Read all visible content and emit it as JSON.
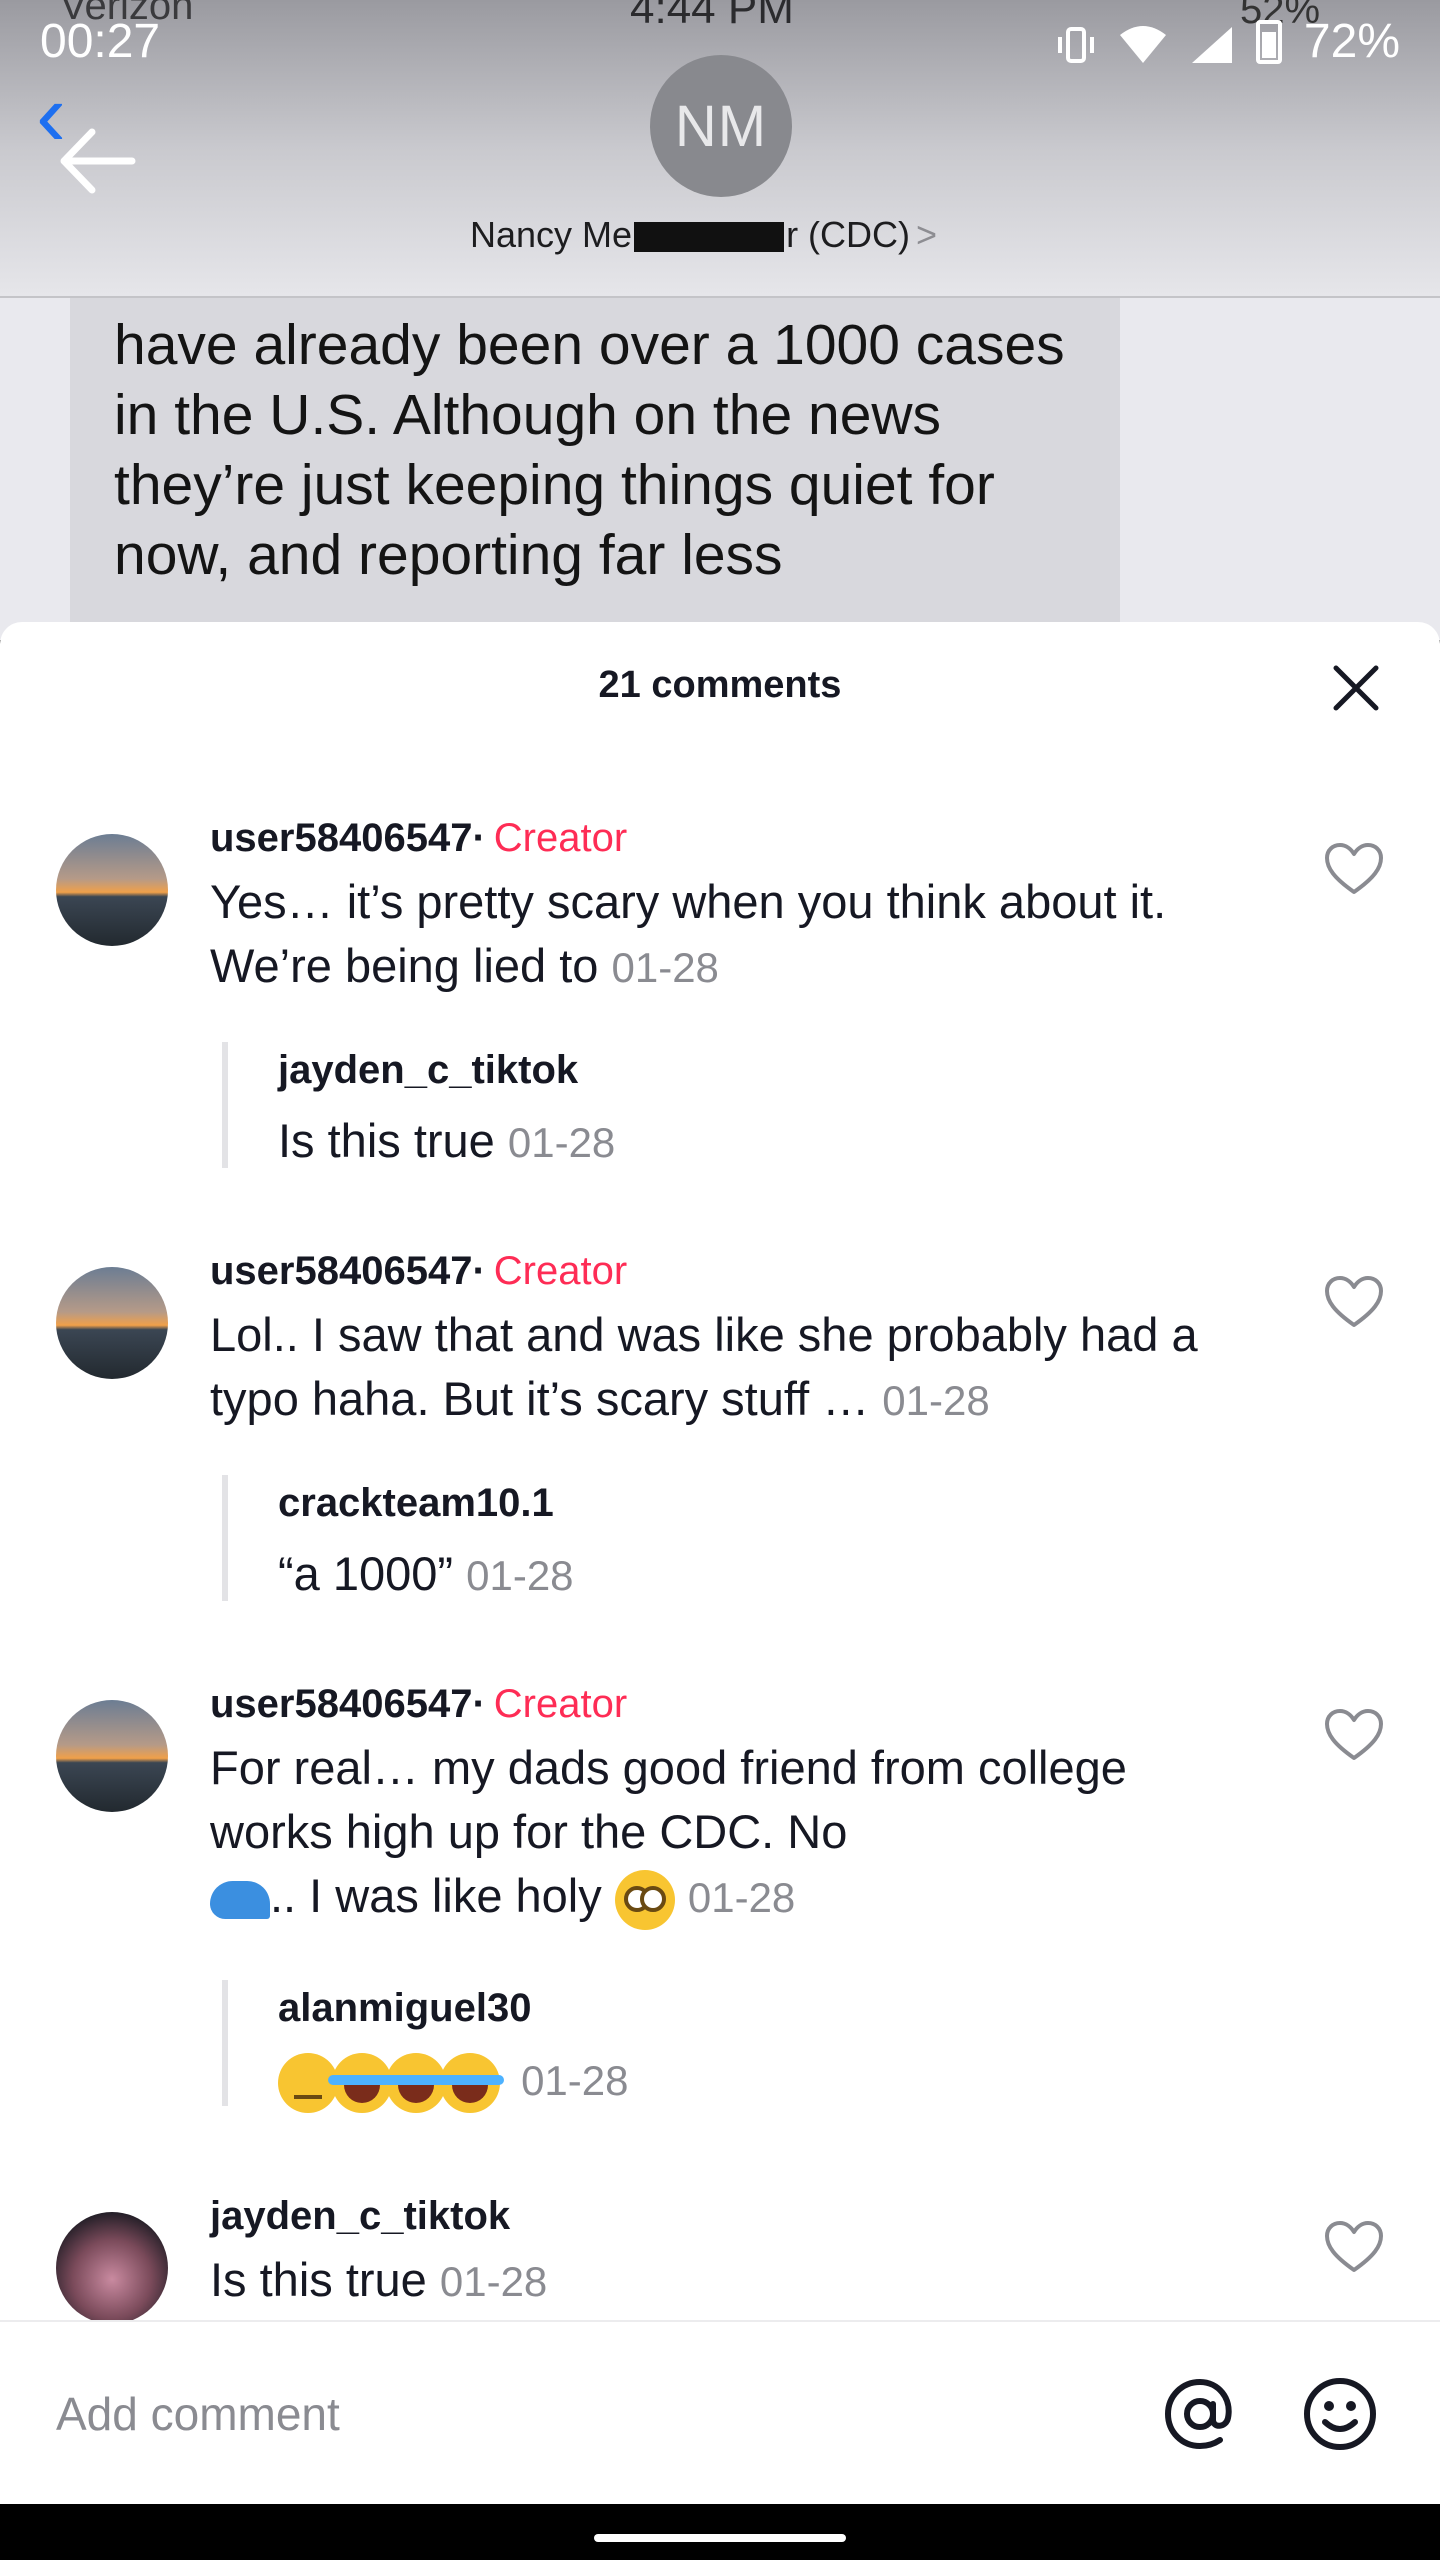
{
  "status_bar": {
    "time": "00:27",
    "battery": "72%"
  },
  "video": {
    "carrier": "Verizon",
    "ghost_time": "4:44 PM",
    "ghost_battery": "52%",
    "contact_initials": "NM",
    "contact_name_start": "Nancy Me",
    "contact_name_end": "r (CDC)",
    "contact_chevron": ">",
    "message_text": "have already been over a 1000 cases in the U.S. Although on the news they’re just keeping things quiet for now, and reporting far less"
  },
  "sheet": {
    "comment_count": "21 comments"
  },
  "comments": [
    {
      "username": "user58406547·",
      "badge": "Creator",
      "text": "Yes… it’s pretty scary when you think about it. We’re being lied to",
      "date": "01-28",
      "reply": {
        "username": "jayden_c_tiktok",
        "text": "Is this true",
        "date": "01-28"
      }
    },
    {
      "username": "user58406547·",
      "badge": "Creator",
      "text": "Lol.. I saw that and was like she probably had a typo haha. But it’s scary stuff …",
      "date": "01-28",
      "reply": {
        "username": "crackteam10.1",
        "text": "“a 1000”",
        "date": "01-28"
      }
    },
    {
      "username": "user58406547·",
      "badge": "Creator",
      "text_line1": "For real… my dads good friend from college works high up for the CDC. No",
      "text_line2": ".. I was like holy",
      "date": "01-28",
      "reply": {
        "username": "alanmiguel30",
        "date": "01-28"
      }
    },
    {
      "username": "jayden_c_tiktok",
      "text": "Is this true",
      "date": "01-28"
    }
  ],
  "comment_bar": {
    "placeholder": "Add comment"
  },
  "icons": {
    "heart": "heart-icon",
    "close": "close-icon",
    "at": "at-icon",
    "emoji": "smiley-icon",
    "back": "back-arrow-icon"
  },
  "colors": {
    "creator": "#fe2c55",
    "text": "#161823",
    "muted": "#8a8b91"
  }
}
